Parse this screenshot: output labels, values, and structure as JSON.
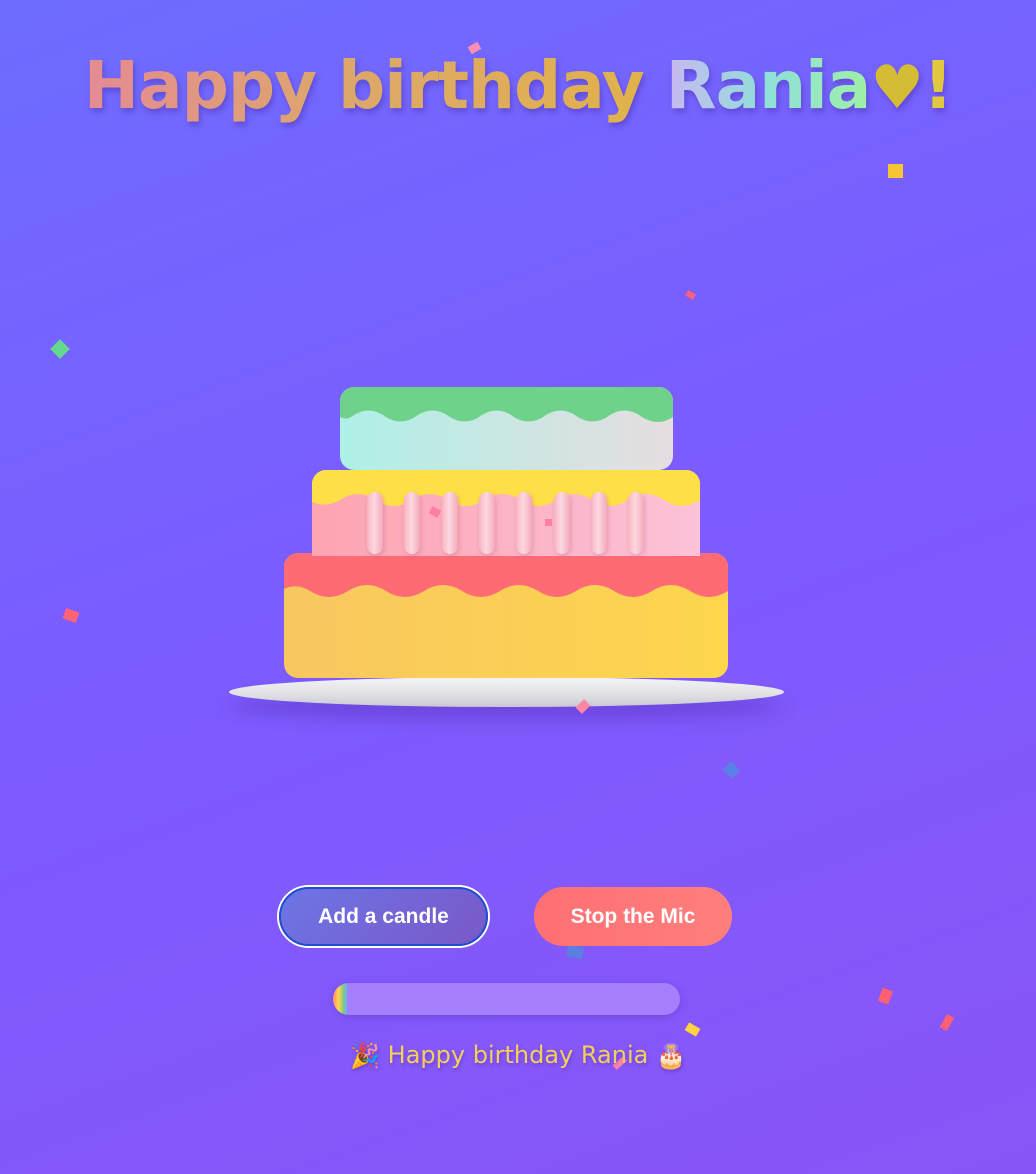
{
  "title": {
    "main": "Happy birthday",
    "name": "Rania",
    "heart_icon": "yellow-heart",
    "exclamation": "!"
  },
  "cake": {
    "tiers": 3,
    "candle_count": 8,
    "colors": {
      "top_icing": "#6fd28a",
      "middle_icing": "#fde047",
      "bottom_icing": "#ff6b75",
      "bottom_cream": "#fdd64d"
    }
  },
  "buttons": {
    "add_candle": "Add a candle",
    "stop_mic": "Stop the Mic"
  },
  "progress": {
    "fraction": 0.04
  },
  "message": {
    "leading_icon": "party-popper",
    "text": "Happy birthday Rania",
    "trailing_icon": "birthday-cake"
  },
  "colors": {
    "background_start": "#6e6cff",
    "background_end": "#8a55f7",
    "add_button": "#6d75e6",
    "stop_button": "#ff6f74",
    "message_text": "#f5cf5a"
  }
}
